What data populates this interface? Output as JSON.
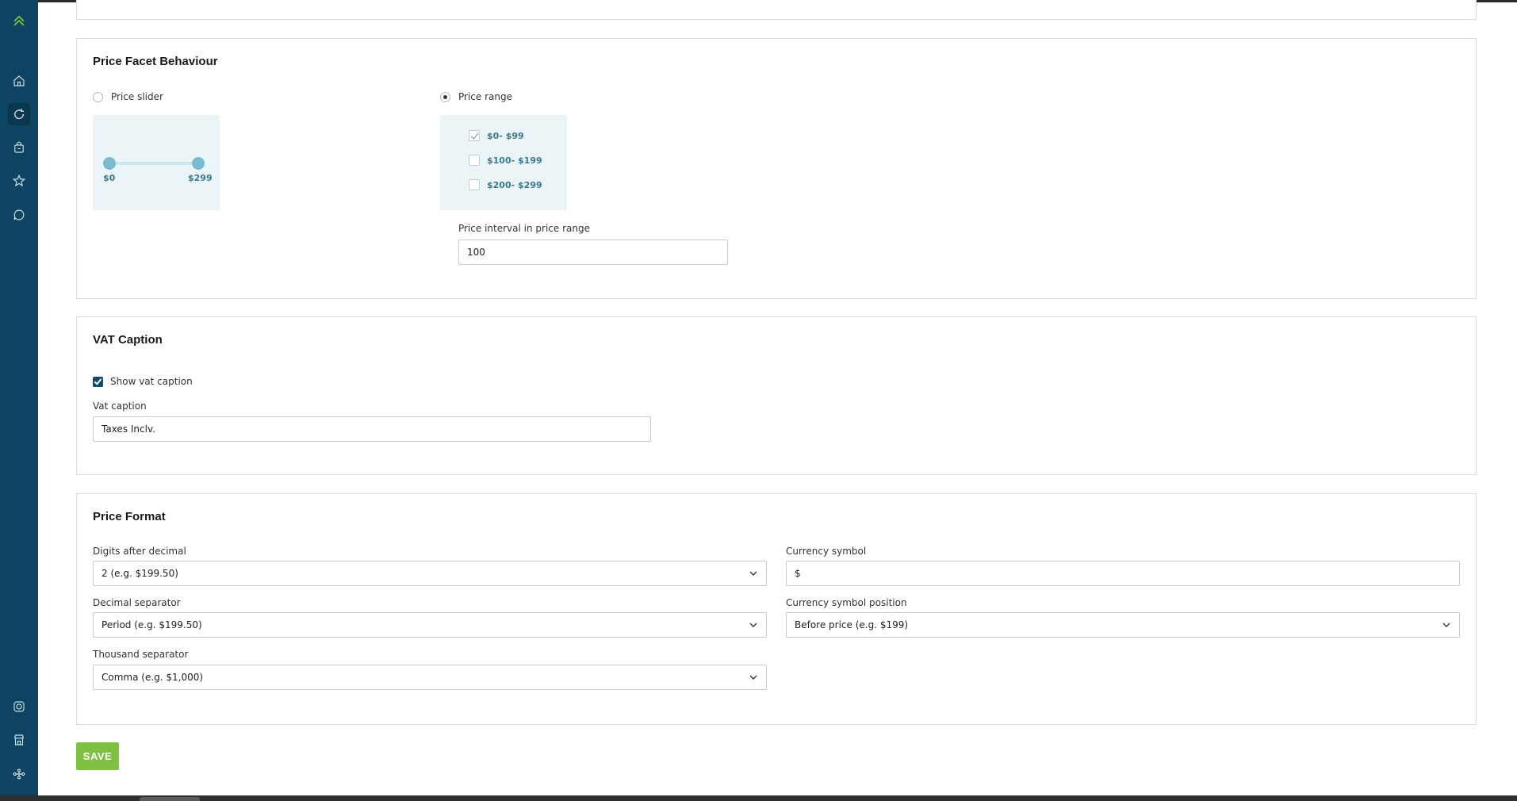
{
  "sidebar": {
    "logo": "chevron-logo",
    "items": [
      {
        "icon": "home-icon"
      },
      {
        "icon": "refresh-icon",
        "active": true
      },
      {
        "icon": "shopping-bag-icon"
      },
      {
        "icon": "star-icon"
      },
      {
        "icon": "chat-icon"
      }
    ],
    "bottom_items": [
      {
        "icon": "instagram-icon"
      },
      {
        "icon": "store-icon"
      },
      {
        "icon": "network-icon"
      }
    ]
  },
  "price_facet": {
    "title": "Price Facet Behaviour",
    "slider_option": {
      "label": "Price slider",
      "selected": false
    },
    "slider_preview": {
      "min_label": "$0",
      "max_label": "$299"
    },
    "range_option": {
      "label": "Price range",
      "selected": true
    },
    "range_preview": [
      {
        "label": "$0- $99",
        "checked": true
      },
      {
        "label": "$100- $199",
        "checked": false
      },
      {
        "label": "$200- $299",
        "checked": false
      }
    ],
    "interval_label": "Price interval in price range",
    "interval_value": "100"
  },
  "vat": {
    "title": "VAT Caption",
    "show_label": "Show vat caption",
    "show_checked": true,
    "caption_label": "Vat caption",
    "caption_value": "Taxes Inclv."
  },
  "price_format": {
    "title": "Price Format",
    "digits_label": "Digits after decimal",
    "digits_value": "2 (e.g. $199.50)",
    "currency_label": "Currency symbol",
    "currency_value": "$",
    "decimal_label": "Decimal separator",
    "decimal_value": "Period (e.g. $199.50)",
    "position_label": "Currency symbol position",
    "position_value": "Before price (e.g. $199)",
    "thousand_label": "Thousand separator",
    "thousand_value": "Comma (e.g. $1,000)"
  },
  "save_label": "SAVE",
  "colors": {
    "sidebar_bg": "#0d4461",
    "accent_green": "#7ec142",
    "preview_bg": "#ebf5f7"
  }
}
